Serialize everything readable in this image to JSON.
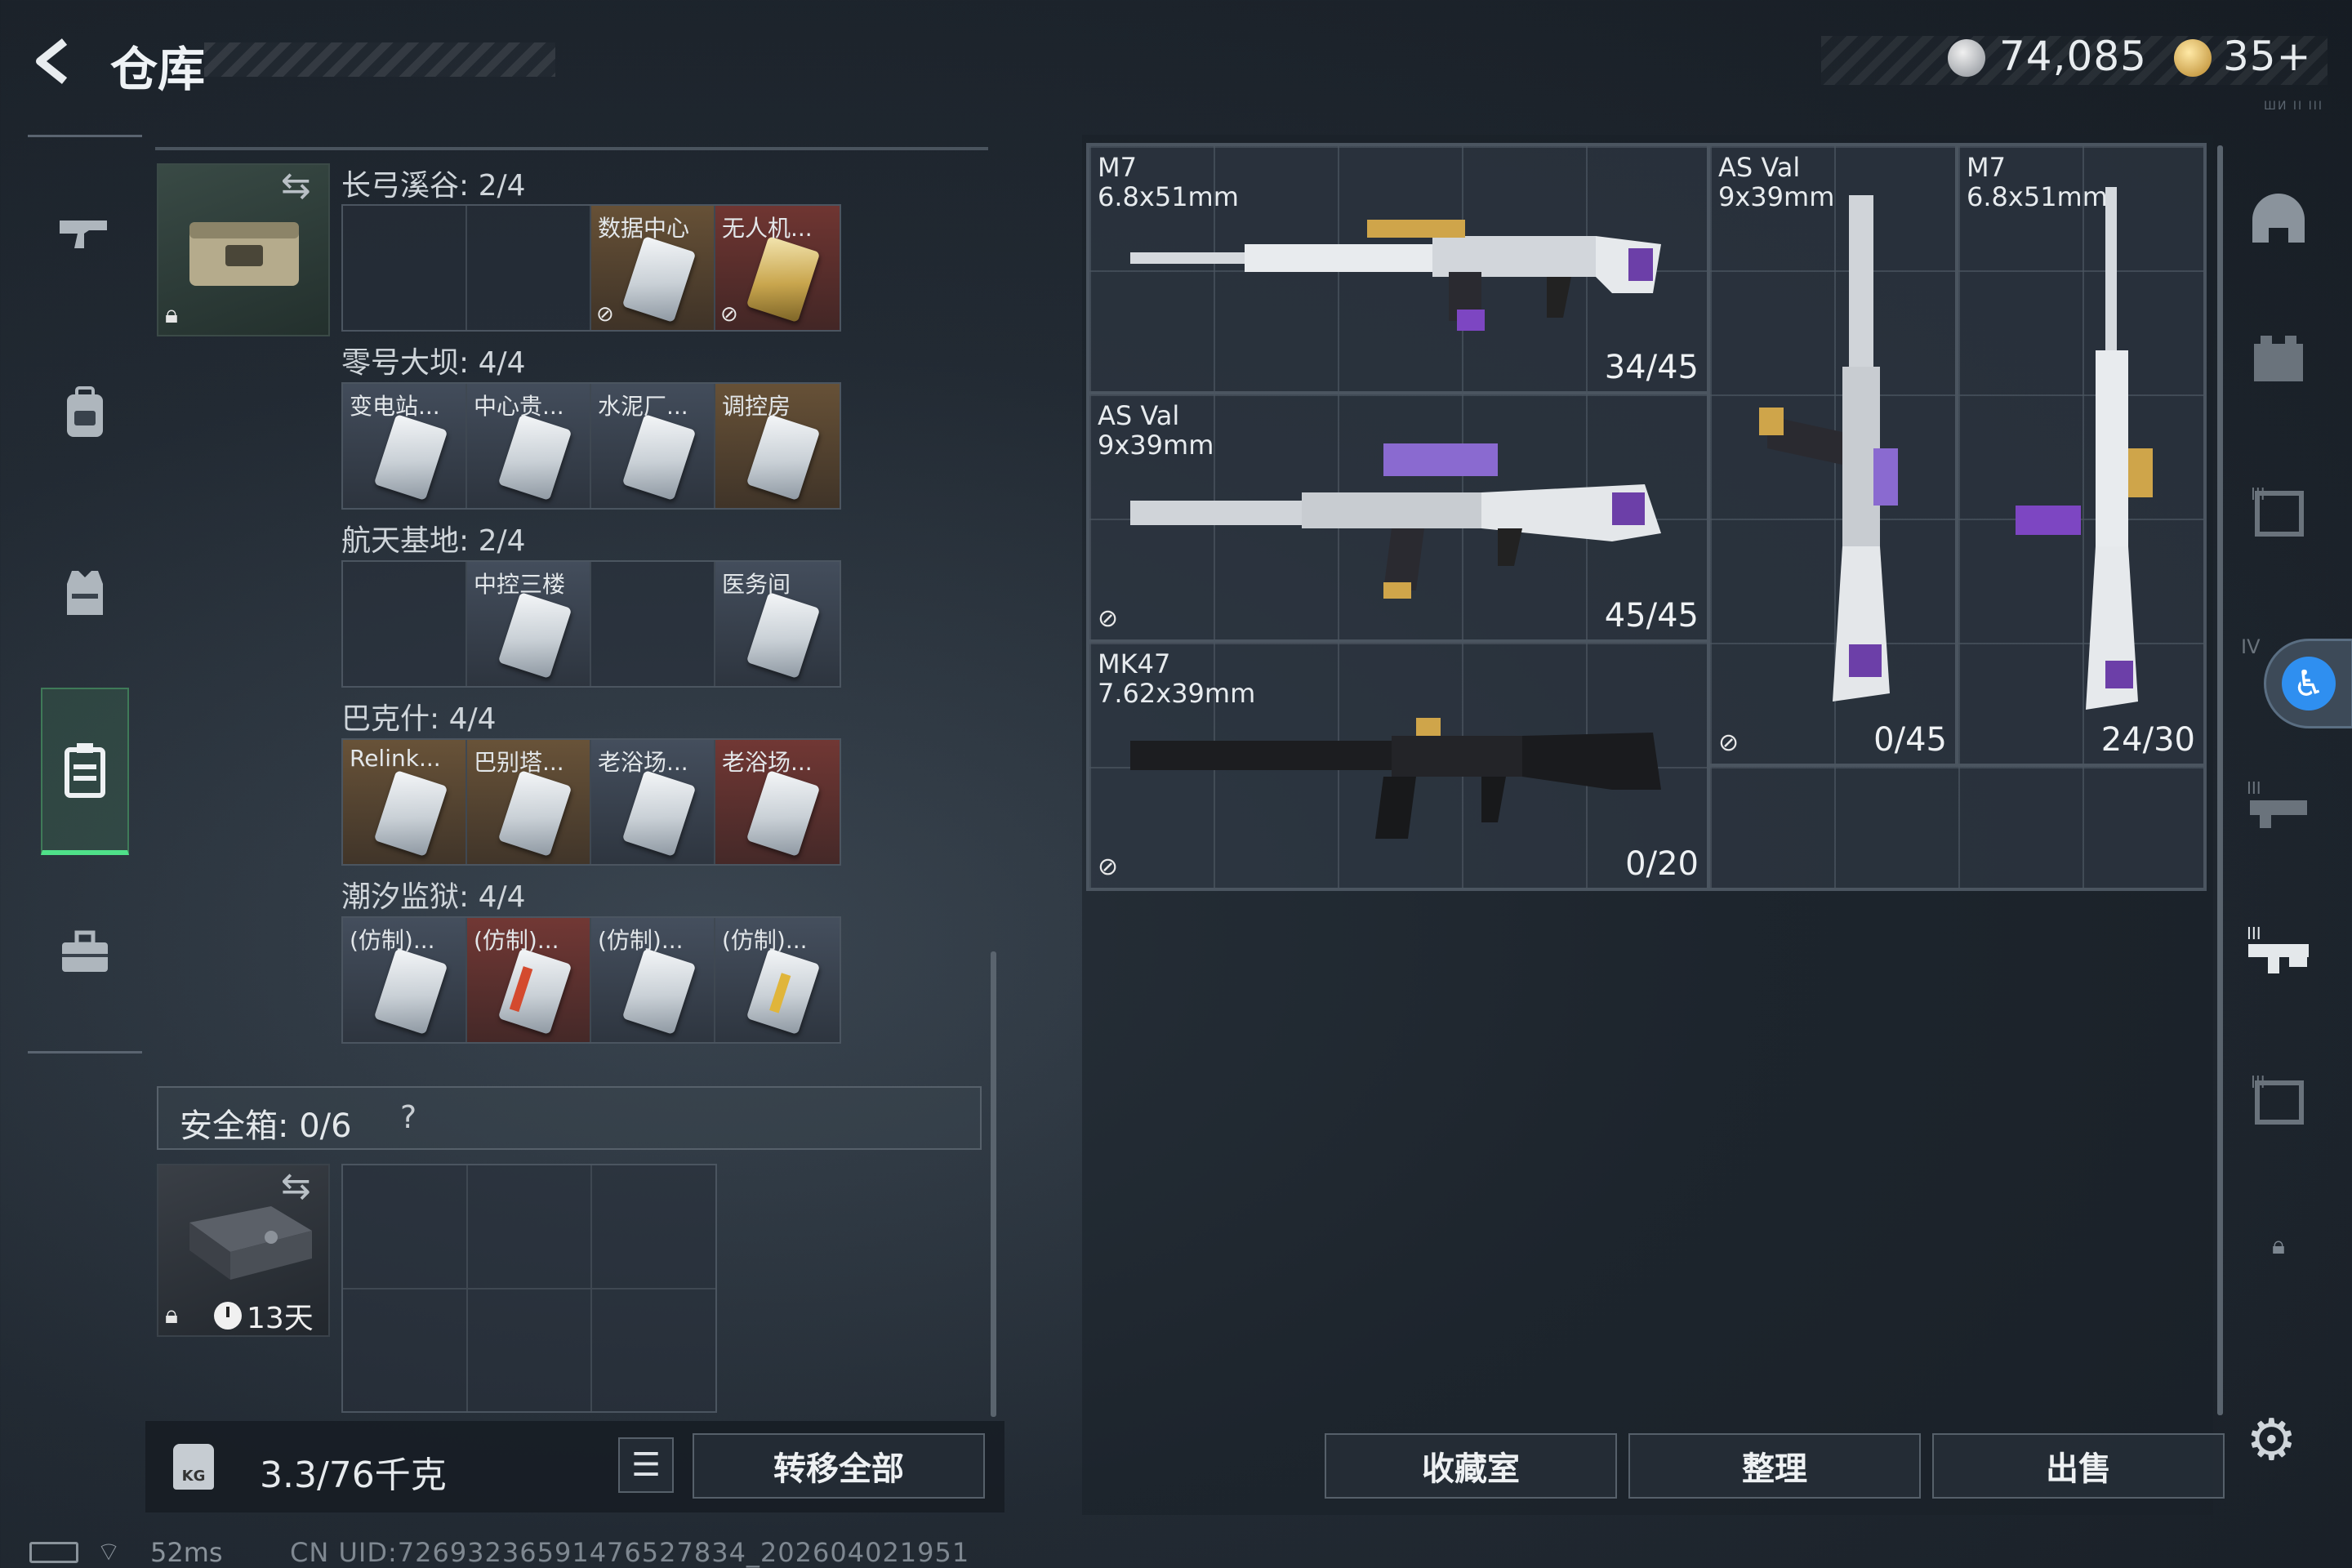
{
  "header": {
    "title": "仓库",
    "silver_amount": "74,085",
    "gold_amount": "35+",
    "mini_label": "ШИ II III"
  },
  "left_nav": {
    "items": [
      "gun-icon",
      "backpack-icon",
      "chest-rig-icon",
      "keycard-case-icon",
      "toolbox-icon"
    ],
    "active": "keycard-case-icon"
  },
  "keycard_case": {
    "sections": [
      {
        "title": "长弓溪谷: 2/4",
        "cells": [
          {
            "label": "",
            "filled": false
          },
          {
            "label": "",
            "filled": false
          },
          {
            "label": "数据中心",
            "filled": true,
            "tint": "gold",
            "nodrop": true
          },
          {
            "label": "无人机...",
            "filled": true,
            "tint": "red",
            "card": "gold",
            "nodrop": true
          }
        ]
      },
      {
        "title": "零号大坝: 4/4",
        "cells": [
          {
            "label": "变电站...",
            "filled": true
          },
          {
            "label": "中心贵...",
            "filled": true
          },
          {
            "label": "水泥厂...",
            "filled": true
          },
          {
            "label": "调控房",
            "filled": true,
            "tint": "gold"
          }
        ]
      },
      {
        "title": "航天基地: 2/4",
        "cells": [
          {
            "label": "",
            "filled": false
          },
          {
            "label": "中控三楼",
            "filled": true
          },
          {
            "label": "",
            "filled": false
          },
          {
            "label": "医务间",
            "filled": true
          }
        ]
      },
      {
        "title": "巴克什: 4/4",
        "cells": [
          {
            "label": "Relink...",
            "filled": true,
            "tint": "gold"
          },
          {
            "label": "巴别塔...",
            "filled": true,
            "tint": "gold"
          },
          {
            "label": "老浴场...",
            "filled": true
          },
          {
            "label": "老浴场...",
            "filled": true,
            "tint": "red"
          }
        ]
      },
      {
        "title": "潮汐监狱: 4/4",
        "cells": [
          {
            "label": "(仿制)...",
            "filled": true
          },
          {
            "label": "(仿制)...",
            "filled": true,
            "tint": "red",
            "stripe": "red"
          },
          {
            "label": "(仿制)...",
            "filled": true
          },
          {
            "label": "(仿制)...",
            "filled": true,
            "stripe": "gold"
          }
        ]
      }
    ]
  },
  "safebox": {
    "title": "安全箱: 0/6",
    "help": "?",
    "timer": "13天"
  },
  "footer_left": {
    "kg_icon": "KG",
    "weight": "3.3/76千克",
    "transfer_label": "转移全部"
  },
  "weapons": [
    {
      "name": "M7",
      "caliber": "6.8x51mm",
      "ammo": "34/45",
      "nodrop": false
    },
    {
      "name": "AS Val",
      "caliber": "9x39mm",
      "ammo": "45/45",
      "nodrop": true
    },
    {
      "name": "MK47",
      "caliber": "7.62x39mm",
      "ammo": "0/20",
      "nodrop": true
    },
    {
      "name": "AS Val",
      "caliber": "9x39mm",
      "ammo": "0/45",
      "nodrop": true
    },
    {
      "name": "M7",
      "caliber": "6.8x51mm",
      "ammo": "24/30",
      "nodrop": false
    }
  ],
  "right_nav": {
    "items": [
      "helmet-icon",
      "armor-icon",
      "tier-3-icon",
      "tier-4-icon",
      "tier-3-rig-icon",
      "tier-3-gun-icon",
      "tier-3-box-icon",
      "lock-icon"
    ]
  },
  "actions": {
    "collection": "收藏室",
    "sort": "整理",
    "sell": "出售"
  },
  "status_bar": {
    "ping": "52ms",
    "uid": "CN UID:72693236591476527834_202604021951"
  }
}
